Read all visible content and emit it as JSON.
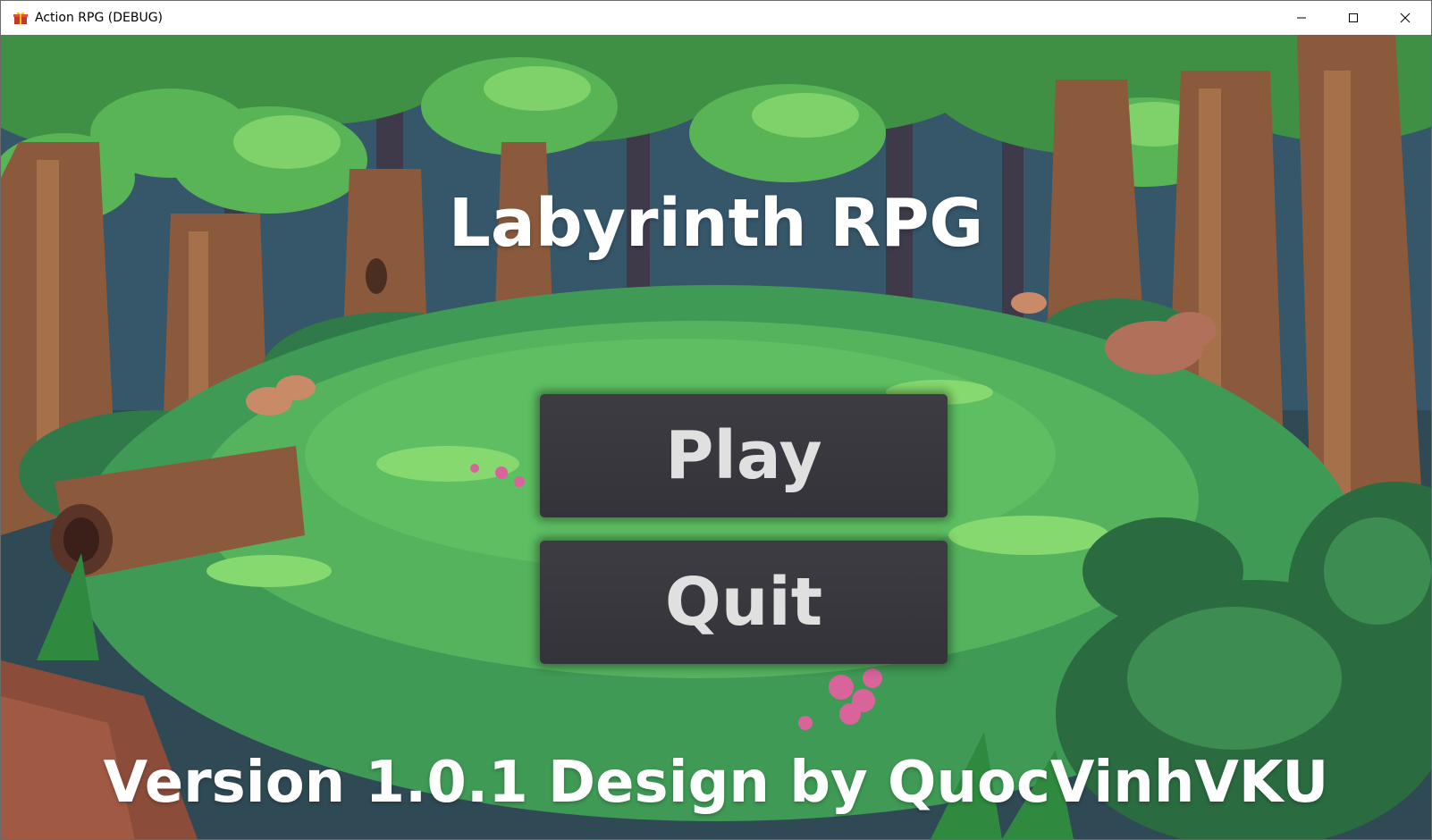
{
  "window": {
    "title": "Action RPG (DEBUG)",
    "icon": "gift-icon",
    "controls": [
      "minimize-icon",
      "maximize-icon",
      "close-icon"
    ]
  },
  "game": {
    "title": "Labyrinth RPG",
    "play_label": "Play",
    "quit_label": "Quit",
    "version_text": "Version 1.0.1 Design by QuocVinhVKU"
  },
  "colors": {
    "button_bg": "#3a3940",
    "button_text": "#e0e0e0",
    "title_text": "#ffffff",
    "grass": "#4fb05a",
    "forest_dark": "#2d6b45"
  }
}
